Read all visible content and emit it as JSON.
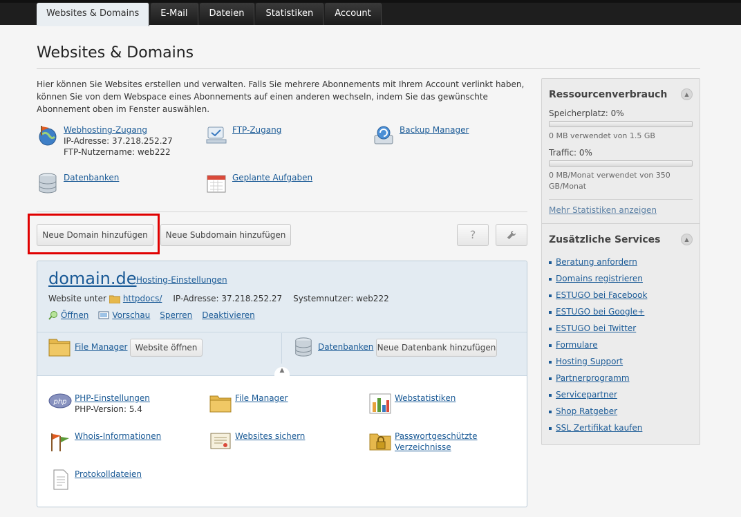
{
  "nav": {
    "tabs": [
      {
        "label": "Websites & Domains",
        "active": true
      },
      {
        "label": "E-Mail"
      },
      {
        "label": "Dateien"
      },
      {
        "label": "Statistiken"
      },
      {
        "label": "Account"
      }
    ]
  },
  "page": {
    "title": "Websites & Domains",
    "intro": "Hier können Sie Websites erstellen und verwalten. Falls Sie mehrere Abonnements mit Ihrem Account verlinkt haben, können Sie von dem Webspace eines Abonnements auf einen anderen wechseln, indem Sie das gewünschte Abonnement oben im Fenster auswählen."
  },
  "quick": {
    "webhosting": {
      "label": "Webhosting-Zugang",
      "ip": "IP-Adresse: 37.218.252.27",
      "ftp_user": "FTP-Nutzername: web222"
    },
    "ftp": {
      "label": "FTP-Zugang"
    },
    "backup": {
      "label": "Backup Manager"
    },
    "databases": {
      "label": "Datenbanken"
    },
    "scheduled": {
      "label": "Geplante Aufgaben"
    }
  },
  "buttons": {
    "add_domain": "Neue Domain hinzufügen",
    "add_subdomain": "Neue Subdomain hinzufügen",
    "help": "?",
    "tools": "wrench-icon"
  },
  "domain": {
    "name": "domain.de",
    "hosting_settings": "Hosting-Einstellungen",
    "website_prefix": "Website unter",
    "docroot": "httpdocs/",
    "ip": "IP-Adresse: 37.218.252.27",
    "sysuser": "Systemnutzer: web222",
    "actions": {
      "open": "Öffnen",
      "preview": "Vorschau",
      "lock": "Sperren",
      "deactivate": "Deaktivieren"
    },
    "file_manager": "File Manager",
    "open_website": "Website öffnen",
    "databases": "Datenbanken",
    "add_database": "Neue Datenbank hinzufügen",
    "tools": {
      "php": {
        "label": "PHP-Einstellungen",
        "sub": "PHP-Version: 5.4"
      },
      "filemanager": {
        "label": "File Manager"
      },
      "webstats": {
        "label": "Webstatistiken"
      },
      "whois": {
        "label": "Whois-Informationen"
      },
      "backup": {
        "label": "Websites sichern"
      },
      "protected_l1": "Passwortgeschützte",
      "protected_l2": "Verzeichnisse",
      "logs": {
        "label": "Protokolldateien"
      }
    }
  },
  "sidebar": {
    "resources": {
      "title": "Ressourcenverbrauch",
      "storage_label": "Speicherplatz: 0%",
      "storage_note": "0 MB verwendet von 1.5 GB",
      "storage_pct": 0,
      "traffic_label": "Traffic: 0%",
      "traffic_note": "0 MB/Monat verwendet von 350 GB/Monat",
      "traffic_pct": 0,
      "more_stats": "Mehr Statistiken anzeigen"
    },
    "services": {
      "title": "Zusätzliche Services",
      "items": [
        "Beratung anfordern",
        "Domains registrieren",
        "ESTUGO bei Facebook",
        "ESTUGO bei Google+",
        "ESTUGO bei Twitter",
        "Formulare",
        "Hosting Support",
        "Partnerprogramm",
        "Servicepartner",
        "Shop Ratgeber",
        "SSL Zertifikat kaufen"
      ]
    }
  }
}
